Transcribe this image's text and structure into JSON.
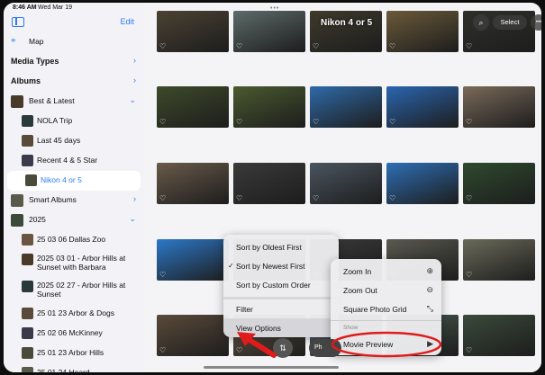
{
  "status": {
    "time": "8:46 AM",
    "date": "Wed Mar 19",
    "dots": "•••"
  },
  "sidebar": {
    "edit_label": "Edit",
    "items": [
      {
        "label": "Map",
        "kind": "item",
        "icon": "map-icon"
      },
      {
        "label": "Media Types",
        "kind": "section",
        "chevron": "›"
      },
      {
        "label": "Albums",
        "kind": "section",
        "chevron": "›"
      },
      {
        "label": "Best & Latest",
        "kind": "item",
        "icon": "folder-thumb",
        "chevron": "⌄"
      },
      {
        "label": "NOLA Trip",
        "kind": "sub"
      },
      {
        "label": "Last 45 days",
        "kind": "sub"
      },
      {
        "label": "Recent 4 & 5 Star",
        "kind": "sub"
      },
      {
        "label": "Nikon 4 or 5",
        "kind": "sub",
        "selected": true
      },
      {
        "label": "Smart Albums",
        "kind": "item",
        "chevron": "›"
      },
      {
        "label": "2025",
        "kind": "item",
        "chevron": "⌄"
      },
      {
        "label": "25 03 06 Dallas Zoo",
        "kind": "sub"
      },
      {
        "label": "2025 03 01 - Arbor Hills at Sunset with Barbara",
        "kind": "sub"
      },
      {
        "label": "2025 02 27 - Arbor Hills at Sunset",
        "kind": "sub"
      },
      {
        "label": "25 01 23 Arbor & Dogs",
        "kind": "sub"
      },
      {
        "label": "25 02 06 McKinney",
        "kind": "sub"
      },
      {
        "label": "25 01 23 Arbor Hills",
        "kind": "sub"
      },
      {
        "label": "25 01 24 Heard",
        "kind": "sub"
      }
    ]
  },
  "main": {
    "title": "Nikon 4 or 5",
    "select_label": "Select",
    "search_icon": "⌕",
    "more_icon": "•••",
    "heart_icon": "♡",
    "photos_label": "Ph"
  },
  "sort_menu": {
    "items": [
      {
        "label": "Sort by Oldest First",
        "checked": false
      },
      {
        "label": "Sort by Newest First",
        "checked": true
      },
      {
        "label": "Sort by Custom Order",
        "checked": false
      },
      {
        "label": "Filter",
        "checked": false
      },
      {
        "label": "View Options",
        "checked": false,
        "highlight": true
      }
    ],
    "check": "✓"
  },
  "view_menu": {
    "items": [
      {
        "label": "Zoom In",
        "icon": "⊕"
      },
      {
        "label": "Zoom Out",
        "icon": "⊖"
      },
      {
        "label": "Square Photo Grid",
        "icon": "⤡"
      }
    ],
    "header": "Show",
    "movie_label": "Movie Preview",
    "movie_icon": "▶",
    "check": "✓"
  },
  "colors": {
    "accent": "#2f7bf6",
    "annotation": "#e01b1b"
  }
}
